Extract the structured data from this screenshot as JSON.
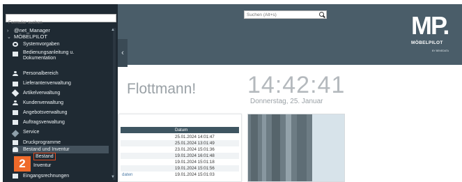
{
  "sidebar": {
    "search_placeholder": "Formular suchen",
    "tree": [
      {
        "chevron": "›",
        "label": "@net_Manager"
      },
      {
        "chevron": "⌄",
        "label": "MÖBELPILOT"
      }
    ],
    "items": [
      {
        "label": "Systemvorgaben",
        "icon": "gear-icon"
      },
      {
        "label": "Bedienungsanleitung u. Dokumentation",
        "icon": "book-icon"
      },
      {
        "label": "Personalbereich",
        "icon": "person-icon"
      },
      {
        "label": "Lieferantenverwaltung",
        "icon": "truck-icon"
      },
      {
        "label": "Artikelverwaltung",
        "icon": "tag-icon"
      },
      {
        "label": "Kundenverwaltung",
        "icon": "customer-icon"
      },
      {
        "label": "Angebotsverwaltung",
        "icon": "document-icon"
      },
      {
        "label": "Auftragsverwaltung",
        "icon": "document-icon"
      },
      {
        "label": "Service",
        "icon": "wrench-icon"
      },
      {
        "label": "Druckprogramme",
        "icon": "printer-icon"
      },
      {
        "label": "Bestand und Inventur",
        "icon": "bulb-icon"
      }
    ],
    "sub_bestand": "Bestand",
    "sub_inventur": "Inventur",
    "next_item": "Eingangsrechnungen",
    "step_badge": "2",
    "scroll_up": "▲",
    "scroll_down": "▼"
  },
  "collapse_tab": "‹",
  "header": {
    "search_placeholder": "Suchen (Alt+s)",
    "logo_mark": "MP.",
    "logo_name": "MÖBELPILOT",
    "logo_sub": "BY BENEDATA"
  },
  "greeting": "Flottmann!",
  "clock": {
    "time": "14:42:41",
    "date": "Donnerstag, 25. Januar"
  },
  "table": {
    "header_date": "Datum",
    "rows": [
      {
        "name": "",
        "date": "25.01.2024 14:01:47"
      },
      {
        "name": "",
        "date": "25.01.2024 13:01:49"
      },
      {
        "name": "",
        "date": "23.01.2024 15:01:36"
      },
      {
        "name": "",
        "date": "19.01.2024 16:01:48"
      },
      {
        "name": "",
        "date": "19.01.2024 15:01:18"
      },
      {
        "name": "",
        "date": "19.01.2024 15:01:56"
      },
      {
        "name": "daten",
        "date": "19.01.2024 15:01:03"
      }
    ]
  },
  "colors": {
    "sidebar_bg": "#1f2a33",
    "header_bg": "#4a5d69",
    "accent": "#ef6a2a",
    "table_header": "#3e5561"
  }
}
